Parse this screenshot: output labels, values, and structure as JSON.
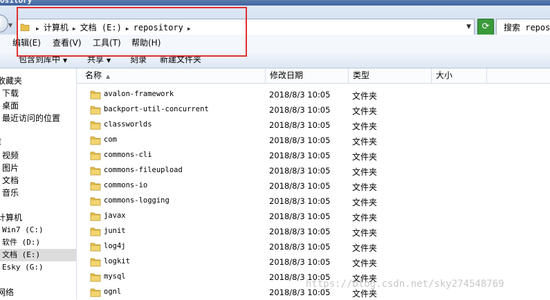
{
  "window": {
    "title_fragment": "ository"
  },
  "address": {
    "crumbs": [
      "计算机",
      "文档 (E:)",
      "repository"
    ],
    "search_placeholder": "搜索 reposi"
  },
  "menu": [
    "编辑(E)",
    "查看(V)",
    "工具(T)",
    "帮助(H)"
  ],
  "toolbar": {
    "include_library": "包含到库中",
    "share": "共享",
    "burn": "刻录",
    "new_folder": "新建文件夹"
  },
  "nav": {
    "favorites": "收藏夹",
    "downloads": "下载",
    "desktop": "桌面",
    "recent": "最近访问的位置",
    "libraries": "库",
    "videos": "视频",
    "pictures": "图片",
    "documents": "文档",
    "music": "音乐",
    "computer": "计算机",
    "drive_c": "Win7 (C:)",
    "drive_d": "软件 (D:)",
    "drive_e": "文档 (E:)",
    "drive_g": "Esky (G:)",
    "network": "网络"
  },
  "columns": {
    "name": "名称",
    "modified": "修改日期",
    "type": "类型",
    "size": "大小"
  },
  "files": [
    {
      "name": "avalon-framework",
      "date": "2018/8/3 10:05",
      "type": "文件夹"
    },
    {
      "name": "backport-util-concurrent",
      "date": "2018/8/3 10:05",
      "type": "文件夹"
    },
    {
      "name": "classworlds",
      "date": "2018/8/3 10:05",
      "type": "文件夹"
    },
    {
      "name": "com",
      "date": "2018/8/3 10:05",
      "type": "文件夹"
    },
    {
      "name": "commons-cli",
      "date": "2018/8/3 10:05",
      "type": "文件夹"
    },
    {
      "name": "commons-fileupload",
      "date": "2018/8/3 10:05",
      "type": "文件夹"
    },
    {
      "name": "commons-io",
      "date": "2018/8/3 10:05",
      "type": "文件夹"
    },
    {
      "name": "commons-logging",
      "date": "2018/8/3 10:05",
      "type": "文件夹"
    },
    {
      "name": "javax",
      "date": "2018/8/3 10:05",
      "type": "文件夹"
    },
    {
      "name": "junit",
      "date": "2018/8/3 10:05",
      "type": "文件夹"
    },
    {
      "name": "log4j",
      "date": "2018/8/3 10:05",
      "type": "文件夹"
    },
    {
      "name": "logkit",
      "date": "2018/8/3 10:05",
      "type": "文件夹"
    },
    {
      "name": "mysql",
      "date": "2018/8/3 10:05",
      "type": "文件夹"
    },
    {
      "name": "ognl",
      "date": "2018/8/3 10:05",
      "type": "文件夹"
    }
  ],
  "watermark": "https://blog.csdn.net/sky274548769",
  "colors": {
    "highlight": "#e0302e",
    "folder": "#e8c14a",
    "selected_bg": "#dcdcdc"
  }
}
